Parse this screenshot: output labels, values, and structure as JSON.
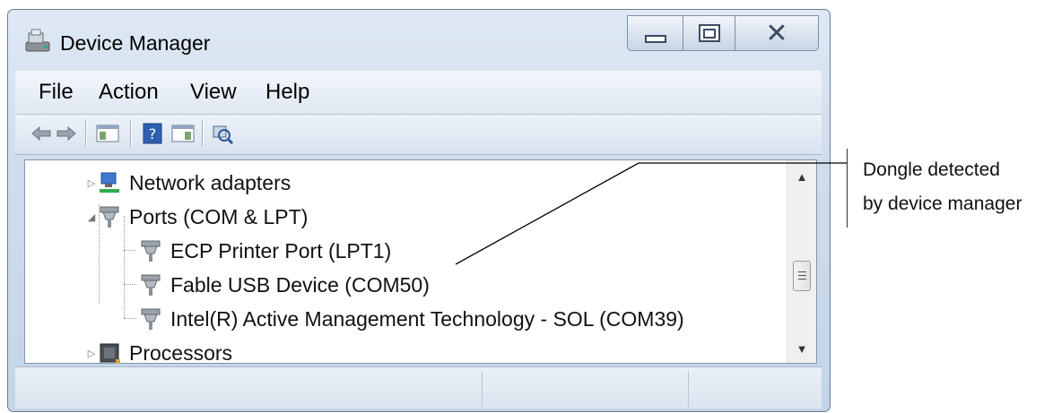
{
  "window": {
    "title": "Device Manager",
    "controls": {
      "minimize": "minimize",
      "maximize": "maximize",
      "close": "close"
    }
  },
  "menu": {
    "items": [
      "File",
      "Action",
      "View",
      "Help"
    ]
  },
  "toolbar": {
    "buttons": [
      "back-arrow-icon",
      "forward-arrow-icon",
      "show-hide-console-tree-icon",
      "help-icon",
      "action-pane-icon",
      "scan-hardware-changes-icon"
    ]
  },
  "tree": {
    "network_adapters": "Network adapters",
    "ports": "Ports (COM & LPT)",
    "ecp_printer": "ECP Printer Port (LPT1)",
    "fable_usb": "Fable USB Device (COM50)",
    "intel_amt": "Intel(R) Active Management Technology - SOL (COM39)",
    "processors": "Processors"
  },
  "annotation": {
    "line1": "Dongle detected",
    "line2": "by device manager"
  },
  "colors": {
    "title_bar": "#cfdcec",
    "border": "#6b7d93",
    "pointer_line": "#000000"
  }
}
